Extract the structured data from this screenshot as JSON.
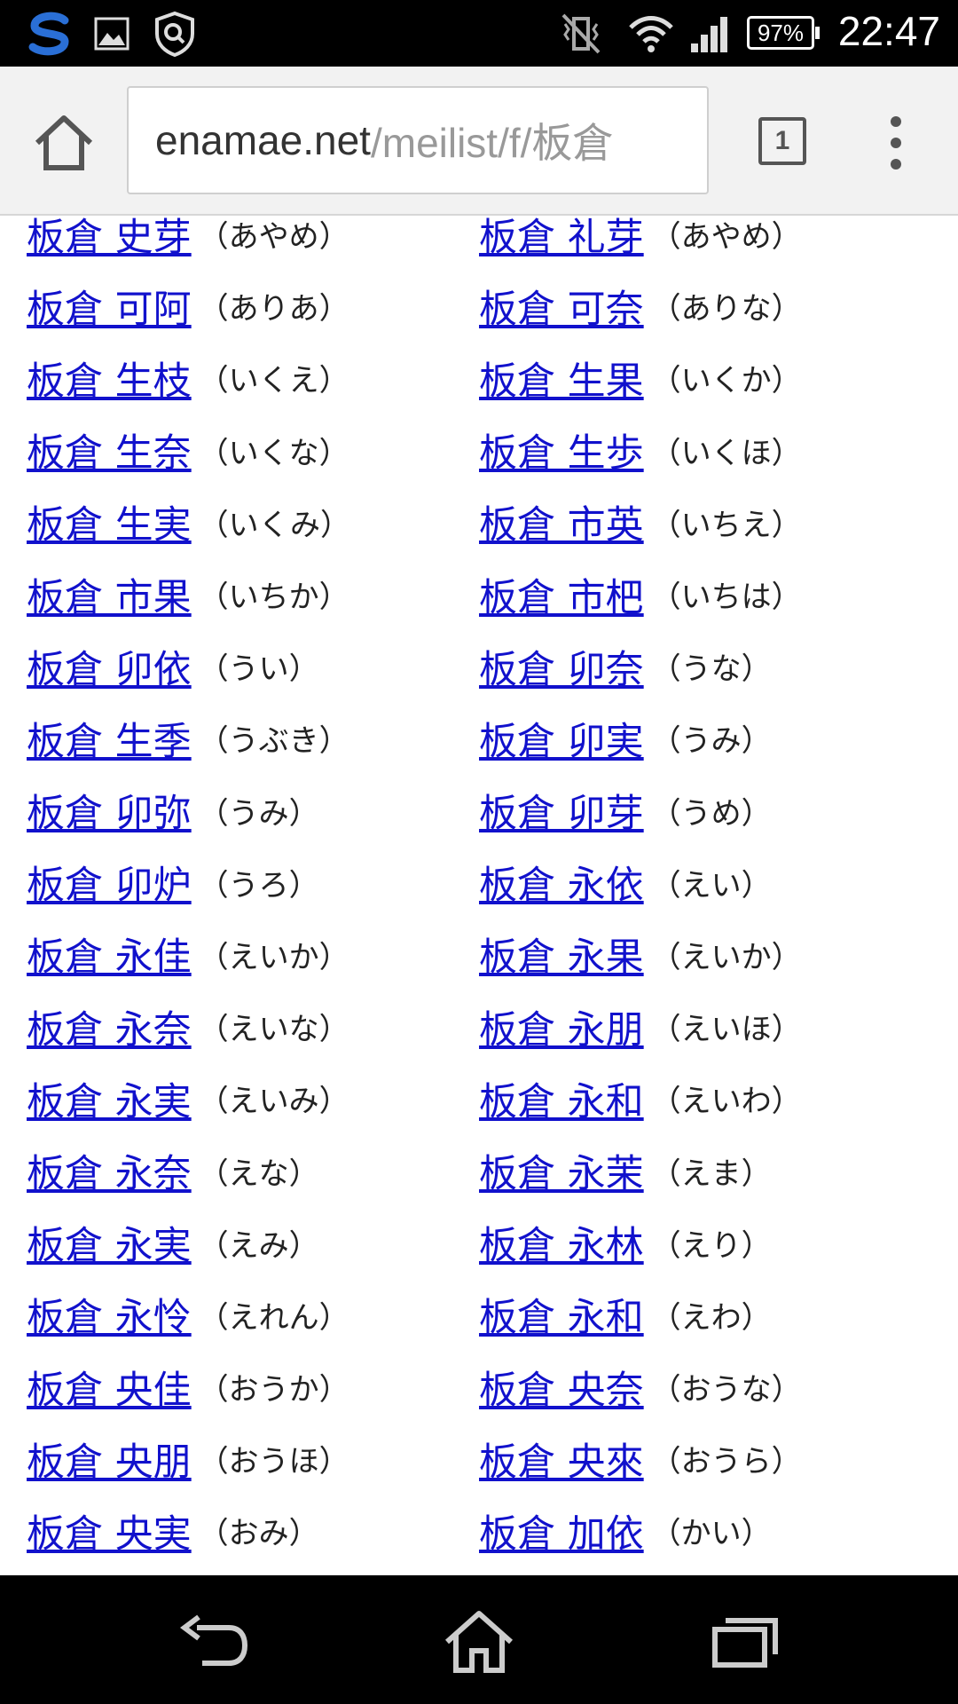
{
  "status_bar": {
    "time": "22:47",
    "battery": "97%",
    "icons": [
      "s-app-icon",
      "image-icon",
      "shield-search-icon",
      "vibrate-off-icon",
      "wifi-icon",
      "signal-icon",
      "battery-icon"
    ]
  },
  "browser": {
    "url_host": "enamae.net",
    "url_path": "/meilist/f/板倉",
    "tab_count": "1"
  },
  "names": [
    {
      "name": "板倉 史芽",
      "reading": "（あやめ）"
    },
    {
      "name": "板倉 礼芽",
      "reading": "（あやめ）"
    },
    {
      "name": "板倉 可阿",
      "reading": "（ありあ）"
    },
    {
      "name": "板倉 可奈",
      "reading": "（ありな）"
    },
    {
      "name": "板倉 生枝",
      "reading": "（いくえ）"
    },
    {
      "name": "板倉 生果",
      "reading": "（いくか）"
    },
    {
      "name": "板倉 生奈",
      "reading": "（いくな）"
    },
    {
      "name": "板倉 生歩",
      "reading": "（いくほ）"
    },
    {
      "name": "板倉 生実",
      "reading": "（いくみ）"
    },
    {
      "name": "板倉 市英",
      "reading": "（いちえ）"
    },
    {
      "name": "板倉 市果",
      "reading": "（いちか）"
    },
    {
      "name": "板倉 市杷",
      "reading": "（いちは）"
    },
    {
      "name": "板倉 卯依",
      "reading": "（うい）"
    },
    {
      "name": "板倉 卯奈",
      "reading": "（うな）"
    },
    {
      "name": "板倉 生季",
      "reading": "（うぶき）"
    },
    {
      "name": "板倉 卯実",
      "reading": "（うみ）"
    },
    {
      "name": "板倉 卯弥",
      "reading": "（うみ）"
    },
    {
      "name": "板倉 卯芽",
      "reading": "（うめ）"
    },
    {
      "name": "板倉 卯炉",
      "reading": "（うろ）"
    },
    {
      "name": "板倉 永依",
      "reading": "（えい）"
    },
    {
      "name": "板倉 永佳",
      "reading": "（えいか）"
    },
    {
      "name": "板倉 永果",
      "reading": "（えいか）"
    },
    {
      "name": "板倉 永奈",
      "reading": "（えいな）"
    },
    {
      "name": "板倉 永朋",
      "reading": "（えいほ）"
    },
    {
      "name": "板倉 永実",
      "reading": "（えいみ）"
    },
    {
      "name": "板倉 永和",
      "reading": "（えいわ）"
    },
    {
      "name": "板倉 永奈",
      "reading": "（えな）"
    },
    {
      "name": "板倉 永茉",
      "reading": "（えま）"
    },
    {
      "name": "板倉 永実",
      "reading": "（えみ）"
    },
    {
      "name": "板倉 永林",
      "reading": "（えり）"
    },
    {
      "name": "板倉 永怜",
      "reading": "（えれん）"
    },
    {
      "name": "板倉 永和",
      "reading": "（えわ）"
    },
    {
      "name": "板倉 央佳",
      "reading": "（おうか）"
    },
    {
      "name": "板倉 央奈",
      "reading": "（おうな）"
    },
    {
      "name": "板倉 央朋",
      "reading": "（おうほ）"
    },
    {
      "name": "板倉 央來",
      "reading": "（おうら）"
    },
    {
      "name": "板倉 央実",
      "reading": "（おみ）"
    },
    {
      "name": "板倉 加依",
      "reading": "（かい）"
    }
  ],
  "colors": {
    "link": "#1111cc",
    "toolbar_bg": "#f2f2f2"
  }
}
